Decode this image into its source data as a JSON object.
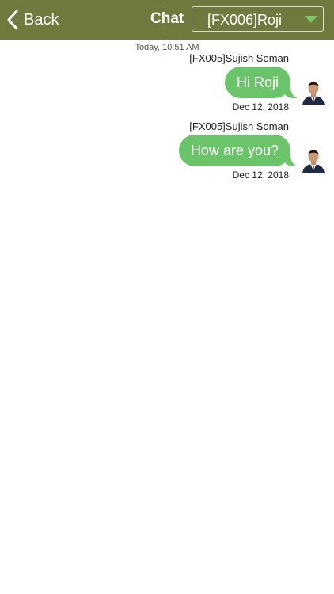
{
  "navbar": {
    "back_label": "Back",
    "title": "Chat",
    "contact_selected": "[FX006]Roji",
    "bar_color": "#6e7a3e",
    "accent_color": "#7cc46d"
  },
  "chat": {
    "day_stamp": "Today, 10:51 AM",
    "bubble_color": "#6cc46a",
    "messages": [
      {
        "sender": "[FX005]Sujish Soman",
        "text": "Hi Roji",
        "date": "Dec 12, 2018"
      },
      {
        "sender": "[FX005]Sujish Soman",
        "text": "How are you?",
        "date": "Dec 12, 2018"
      }
    ]
  },
  "icons": {
    "back": "chevron-left-icon",
    "dropdown": "triangle-down-icon",
    "avatar": "user-avatar"
  }
}
